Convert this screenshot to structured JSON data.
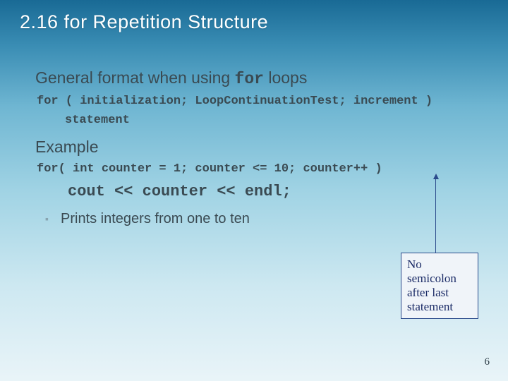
{
  "title": "2.16 for Repetition Structure",
  "bullets": {
    "item1_pre": "General format when using ",
    "item1_code": "for",
    "item1_post": " loops",
    "code1": "for ( initialization; LoopContinuationTest; increment )",
    "code1b": "statement",
    "item2": "Example",
    "code2": "for( int counter = 1; counter <= 10; counter++ )",
    "code3": "cout << counter << endl;",
    "sub1": "Prints integers from one to ten"
  },
  "callout": "No semicolon after last statement",
  "page": "6",
  "markers": {
    "top": "",
    "sub": "▪"
  }
}
